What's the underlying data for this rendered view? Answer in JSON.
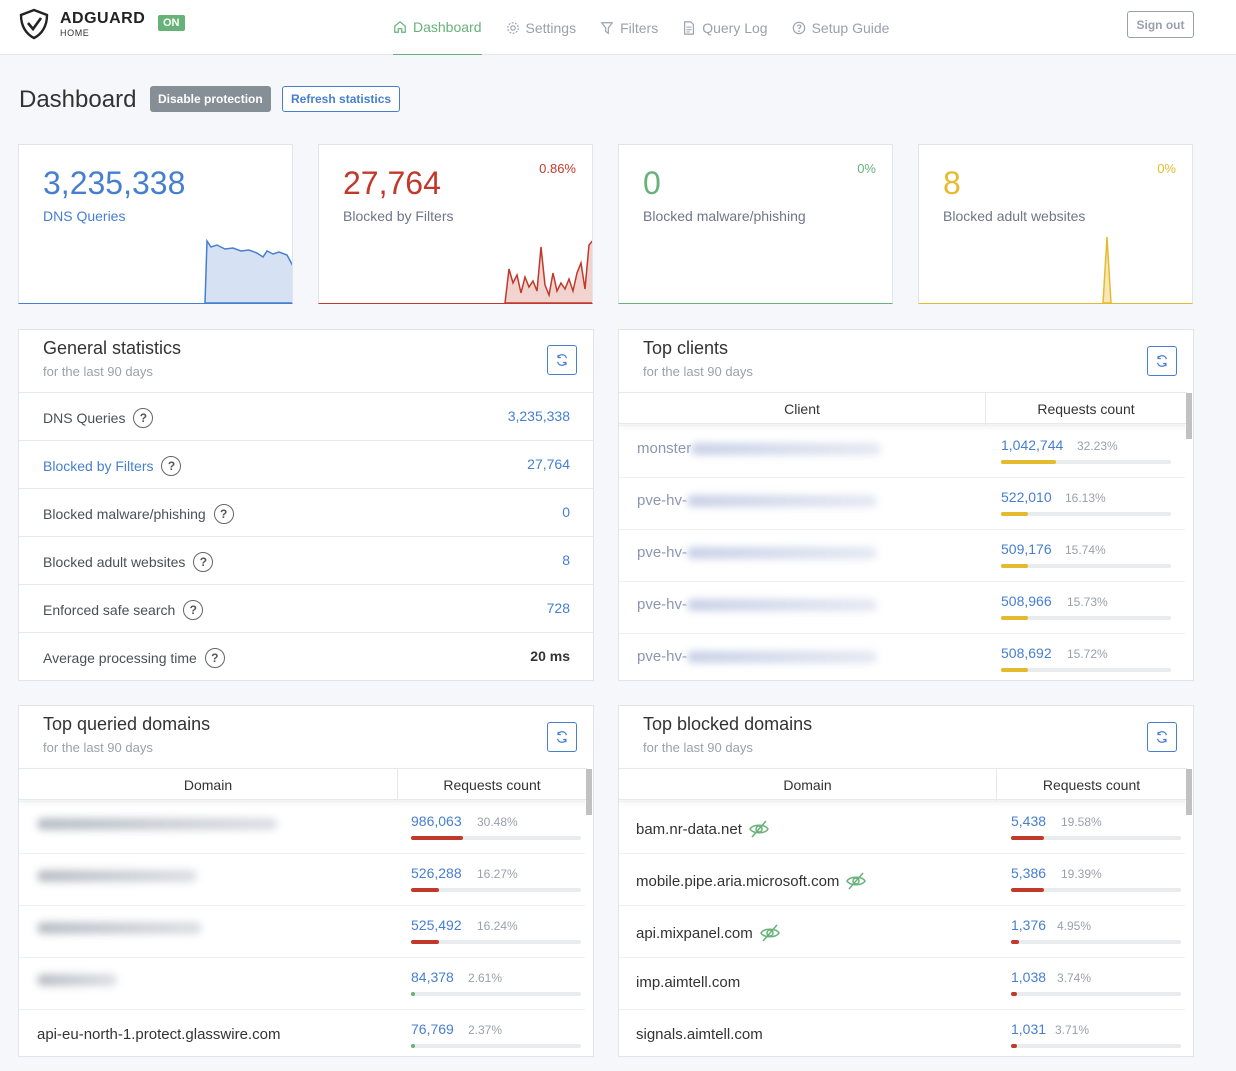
{
  "header": {
    "logo_title": "ADGUARD",
    "logo_sub": "HOME",
    "status_badge": "ON",
    "nav": [
      {
        "label": "Dashboard",
        "icon": "home-icon",
        "active": true
      },
      {
        "label": "Settings",
        "icon": "gear-icon"
      },
      {
        "label": "Filters",
        "icon": "filter-icon"
      },
      {
        "label": "Query Log",
        "icon": "document-icon"
      },
      {
        "label": "Setup Guide",
        "icon": "help-circle-icon"
      }
    ],
    "sign_out": "Sign out"
  },
  "page": {
    "title": "Dashboard",
    "disable_protection": "Disable protection",
    "refresh_statistics": "Refresh statistics"
  },
  "stats": [
    {
      "value": "3,235,338",
      "label": "DNS Queries",
      "percent": "",
      "color": "#467fcf"
    },
    {
      "value": "27,764",
      "label": "Blocked by Filters",
      "percent": "0.86%",
      "color": "#c0392b"
    },
    {
      "value": "0",
      "label": "Blocked malware/phishing",
      "percent": "0%",
      "color": "#67b279"
    },
    {
      "value": "8",
      "label": "Blocked adult websites",
      "percent": "0%",
      "color": "#e5bb2e"
    }
  ],
  "general": {
    "title": "General statistics",
    "subtitle": "for the last 90 days",
    "rows": [
      {
        "label": "DNS Queries",
        "value": "3,235,338"
      },
      {
        "label": "Blocked by Filters",
        "value": "27,764"
      },
      {
        "label": "Blocked malware/phishing",
        "value": "0"
      },
      {
        "label": "Blocked adult websites",
        "value": "8"
      },
      {
        "label": "Enforced safe search",
        "value": "728"
      },
      {
        "label": "Average processing time",
        "value": "20 ms"
      }
    ]
  },
  "top_clients": {
    "title": "Top clients",
    "subtitle": "for the last 90 days",
    "col_client": "Client",
    "col_count": "Requests count",
    "rows": [
      {
        "name": "monster",
        "count": "1,042,744",
        "percent": "32.23%",
        "fill": 0.3223
      },
      {
        "name": "pve-hv-",
        "count": "522,010",
        "percent": "16.13%",
        "fill": 0.1613
      },
      {
        "name": "pve-hv-",
        "count": "509,176",
        "percent": "15.74%",
        "fill": 0.1574
      },
      {
        "name": "pve-hv-",
        "count": "508,966",
        "percent": "15.73%",
        "fill": 0.1573
      },
      {
        "name": "pve-hv-",
        "count": "508,692",
        "percent": "15.72%",
        "fill": 0.1572
      }
    ]
  },
  "top_queried": {
    "title": "Top queried domains",
    "subtitle": "for the last 90 days",
    "col_domain": "Domain",
    "col_count": "Requests count",
    "rows": [
      {
        "name": "",
        "count": "986,063",
        "percent": "30.48%",
        "fill": 0.3048,
        "color": "#c0392b"
      },
      {
        "name": "",
        "count": "526,288",
        "percent": "16.27%",
        "fill": 0.1627,
        "color": "#c0392b"
      },
      {
        "name": "",
        "count": "525,492",
        "percent": "16.24%",
        "fill": 0.1624,
        "color": "#c0392b"
      },
      {
        "name": "",
        "count": "84,378",
        "percent": "2.61%",
        "fill": 0.0261,
        "color": "#67b279"
      },
      {
        "name": "api-eu-north-1.protect.glasswire.com",
        "count": "76,769",
        "percent": "2.37%",
        "fill": 0.0237,
        "color": "#67b279"
      }
    ]
  },
  "top_blocked": {
    "title": "Top blocked domains",
    "subtitle": "for the last 90 days",
    "col_domain": "Domain",
    "col_count": "Requests count",
    "rows": [
      {
        "name": "bam.nr-data.net",
        "count": "5,438",
        "percent": "19.58%",
        "fill": 0.1958,
        "tracker": true
      },
      {
        "name": "mobile.pipe.aria.microsoft.com",
        "count": "5,386",
        "percent": "19.39%",
        "fill": 0.1939,
        "tracker": true
      },
      {
        "name": "api.mixpanel.com",
        "count": "1,376",
        "percent": "4.95%",
        "fill": 0.0495,
        "tracker": true
      },
      {
        "name": "imp.aimtell.com",
        "count": "1,038",
        "percent": "3.74%",
        "fill": 0.0374,
        "tracker": false
      },
      {
        "name": "signals.aimtell.com",
        "count": "1,031",
        "percent": "3.71%",
        "fill": 0.0371,
        "tracker": false
      }
    ]
  }
}
